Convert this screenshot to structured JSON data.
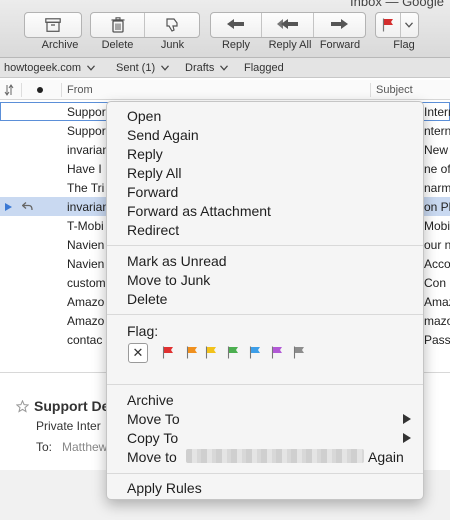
{
  "window": {
    "title": "Inbox — Google"
  },
  "toolbar": {
    "archive": "Archive",
    "delete": "Delete",
    "junk": "Junk",
    "reply": "Reply",
    "reply_all": "Reply All",
    "forward": "Forward",
    "flag": "Flag",
    "flag_color": "#d42e2e"
  },
  "favorites": {
    "account": "howtogeek.com",
    "sent": "Sent (1)",
    "drafts": "Drafts",
    "flagged": "Flagged"
  },
  "columns": {
    "from": "From",
    "subject": "Subject"
  },
  "messages": [
    {
      "from": "Suppor",
      "subject": "Intern"
    },
    {
      "from": "Suppor",
      "subject": "nterni"
    },
    {
      "from": "invarian",
      "subject": "New T"
    },
    {
      "from": "Have I",
      "subject": "ne of"
    },
    {
      "from": "The Tri",
      "subject": "narma"
    },
    {
      "from": "invarian",
      "subject": "on Pl"
    },
    {
      "from": "T-Mobi",
      "subject": "Mobile"
    },
    {
      "from": "Navien",
      "subject": "our n"
    },
    {
      "from": "Navien",
      "subject": "Accou"
    },
    {
      "from": "custom",
      "subject": "Con"
    },
    {
      "from": "Amazo",
      "subject": "Amazo"
    },
    {
      "from": "Amazo",
      "subject": "mazon"
    },
    {
      "from": "contac",
      "subject": "Pass"
    }
  ],
  "preview": {
    "sender": "Support De",
    "subject": "Private Inter",
    "to_label": "To:",
    "to_value": "Matthew"
  },
  "context_menu": {
    "open": "Open",
    "send_again": "Send Again",
    "reply": "Reply",
    "reply_all": "Reply All",
    "forward": "Forward",
    "forward_attachment": "Forward as Attachment",
    "redirect": "Redirect",
    "mark_unread": "Mark as Unread",
    "move_junk": "Move to Junk",
    "delete": "Delete",
    "flag_label": "Flag:",
    "flag_clear": "✕",
    "flag_colors": [
      "#e03131",
      "#f0901e",
      "#f2c21b",
      "#4caf50",
      "#3d9ee8",
      "#b259d6",
      "#8d8d8d"
    ],
    "archive": "Archive",
    "move_to": "Move To",
    "copy_to": "Copy To",
    "move_prefix": "Move to",
    "move_suffix": "Again",
    "apply_rules": "Apply Rules"
  }
}
